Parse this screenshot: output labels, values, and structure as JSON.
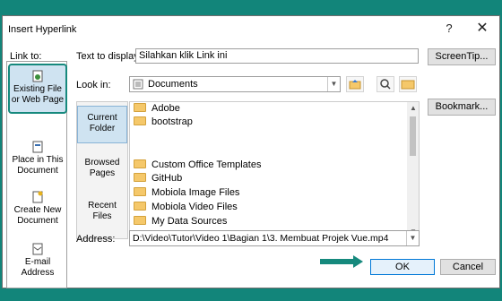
{
  "dialog": {
    "title": "Insert Hyperlink",
    "help": "?",
    "close": "✕"
  },
  "link_to": {
    "label": "Link to:",
    "items": [
      {
        "line1": "Existing File",
        "line2": "or Web Page"
      },
      {
        "line1": "Place in This",
        "line2": "Document"
      },
      {
        "line1": "Create New",
        "line2": "Document"
      },
      {
        "line1": "E-mail",
        "line2": "Address"
      }
    ]
  },
  "text_to_display": {
    "label": "Text to display:",
    "value": "Silahkan klik Link ini"
  },
  "screentip_button": "ScreenTip...",
  "look_in": {
    "label": "Look in:",
    "value": "Documents"
  },
  "bookmark_button": "Bookmark...",
  "places": [
    {
      "line1": "Current",
      "line2": "Folder"
    },
    {
      "line1": "Browsed",
      "line2": "Pages"
    },
    {
      "line1": "Recent",
      "line2": "Files"
    }
  ],
  "files": [
    "Adobe",
    "bootstrap",
    "Custom Office Templates",
    "GitHub",
    "Mobiola Image Files",
    "Mobiola Video Files",
    "My Data Sources"
  ],
  "address": {
    "label": "Address:",
    "value": "D:\\Video\\Tutor\\Video 1\\Bagian 1\\3. Membuat Projek Vue.mp4"
  },
  "ok_button": "OK",
  "cancel_button": "Cancel",
  "colors": {
    "accent": "#16897d",
    "selected": "#cfe3f1"
  }
}
